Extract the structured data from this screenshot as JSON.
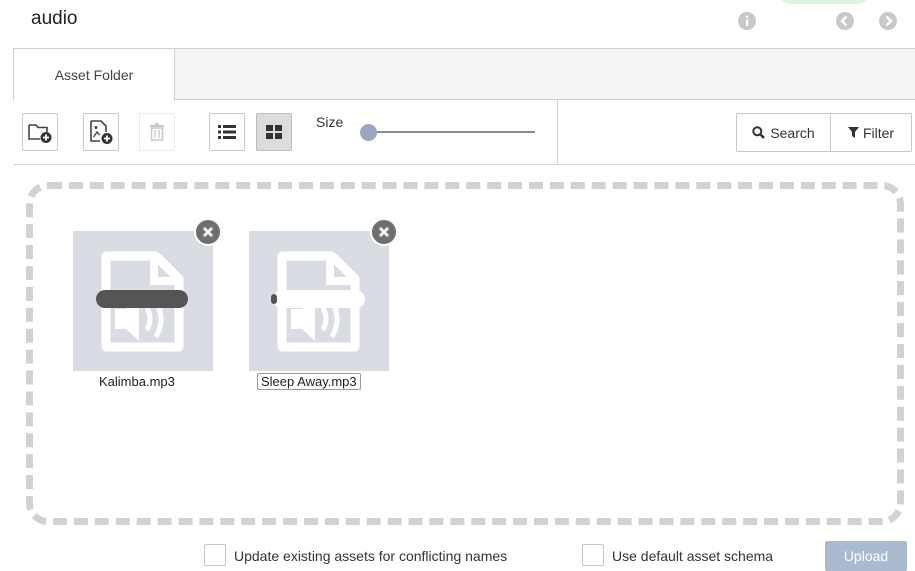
{
  "window": {
    "title": "audio"
  },
  "header_icons": [
    {
      "name": "info-icon",
      "color": "#c8c8c8"
    },
    {
      "name": "back-icon",
      "color": "#c8c8c8"
    },
    {
      "name": "forward-icon",
      "color": "#c8c8c8"
    }
  ],
  "tabs": [
    {
      "label": "Asset Folder",
      "active": true
    }
  ],
  "toolbar": {
    "new_folder_icon": "folder-add-icon",
    "new_asset_icon": "image-add-icon",
    "delete_icon": "trash-icon",
    "list_view_icon": "list-view-icon",
    "grid_view_icon": "grid-view-icon",
    "view_mode": "grid",
    "size_label": "Size",
    "size_value": 0,
    "search_label": "Search",
    "filter_label": "Filter"
  },
  "assets": [
    {
      "name": "Kalimba.mp3",
      "icon": "audio-file-icon",
      "selected": false,
      "loading_bar_color": "#555555"
    },
    {
      "name": "Sleep Away.mp3",
      "icon": "audio-file-icon",
      "selected": true,
      "loading_bar_color": "#ffffff"
    }
  ],
  "footer": {
    "update_existing_label": "Update existing assets for conflicting names",
    "update_existing_checked": false,
    "default_schema_label": "Use default asset schema",
    "default_schema_checked": false,
    "upload_label": "Upload"
  },
  "colors": {
    "tile_bg": "#d9dce3",
    "upload_bg": "#a9bad1",
    "slider_knob": "#9aa8bd",
    "dropzone_border": "#d2d2d2"
  }
}
